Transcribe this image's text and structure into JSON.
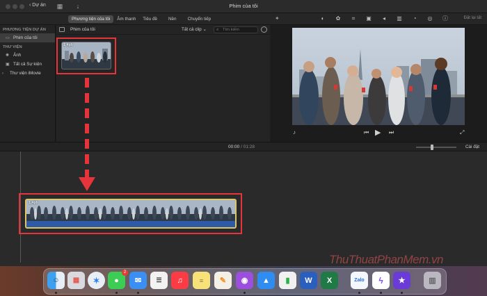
{
  "titlebar": {
    "back_label": "Dự án",
    "title": "Phim của tôi"
  },
  "toolbar": {
    "tabs": [
      "Phương tiện của tôi",
      "Âm thanh",
      "Tiêu đề",
      "Nền",
      "Chuyển tiếp"
    ],
    "active_tab": "Phương tiện của tôi",
    "reset_label": "Đặt lại tất"
  },
  "sidebar": {
    "section_project": "PHƯƠNG TIỆN DỰ ÁN",
    "project_item": "Phim của tôi",
    "section_library": "THƯ VIỆN",
    "library_items": [
      "Ảnh",
      "Tất cả Sự kiện"
    ],
    "imovie_library": "Thư viện iMovie"
  },
  "browser": {
    "name": "Phim của tôi",
    "filter": "Tất cả clip",
    "search_placeholder": "Tìm kiếm",
    "clip_duration": "1,4ph"
  },
  "timeline": {
    "current_time": "00:00",
    "total_time": "01:28",
    "settings_label": "Cài đặt",
    "clip_duration": "1,4ph",
    "zoom_level": 0.38
  },
  "dock": {
    "apps": [
      "finder-icon",
      "launchpad-icon",
      "safari-icon",
      "messages-icon",
      "mail-icon",
      "reminders-icon",
      "music-icon",
      "notes-icon",
      "pages-icon",
      "podcasts-icon",
      "keynote-icon",
      "numbers-icon",
      "word-icon",
      "excel-icon",
      "zalo-icon",
      "messenger-icon",
      "imovie-icon",
      "trash-icon"
    ],
    "messages_badge": "2"
  },
  "watermark": {
    "part1": "ThuThuat",
    "part2": "PhanMem",
    "part3": ".vn"
  },
  "colors": {
    "annotation_red": "#e5343a",
    "clip_selection": "#d9c76a",
    "audio_blue": "#2f5ba6"
  }
}
